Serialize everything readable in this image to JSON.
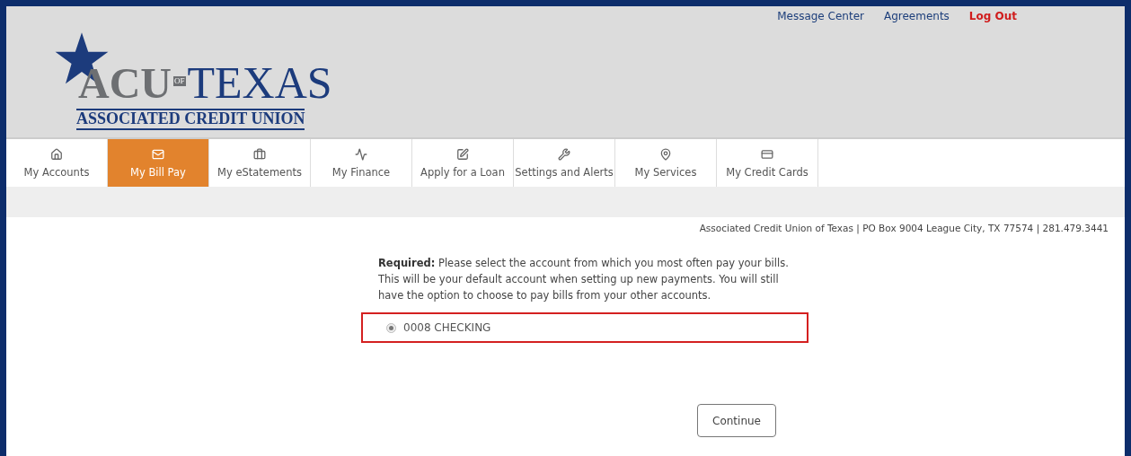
{
  "top_links": [
    {
      "label": "Message Center",
      "kind": "normal"
    },
    {
      "label": "Agreements",
      "kind": "normal"
    },
    {
      "label": "Log Out",
      "kind": "alert"
    }
  ],
  "logo": {
    "acu": "ACU",
    "of": "OF",
    "texas": "TEXAS",
    "subtitle": "ASSOCIATED CREDIT UNION"
  },
  "tabs": [
    {
      "label": "My Accounts",
      "selected": false
    },
    {
      "label": "My Bill Pay",
      "selected": true
    },
    {
      "label": "My eStatements",
      "selected": false
    },
    {
      "label": "My Finance",
      "selected": false
    },
    {
      "label": "Apply for a Loan",
      "selected": false
    },
    {
      "label": "Settings and Alerts",
      "selected": false
    },
    {
      "label": "My Services",
      "selected": false
    },
    {
      "label": "My Credit Cards",
      "selected": false
    }
  ],
  "address_line": "Associated Credit Union of Texas | PO Box 9004 League City, TX 77574 | 281.479.3441",
  "instructions": "**Required:** Please select the account from which you most often pay your bills. This will be your default account when setting up new payments. You will still have the option to choose to pay bills from your other accounts.",
  "accounts": [
    {
      "label": "0008 CHECKING",
      "selected": true
    }
  ],
  "continue_button": "Continue"
}
